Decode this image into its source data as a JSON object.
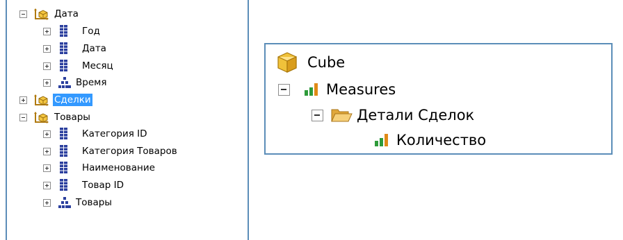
{
  "left_tree": {
    "nodes": [
      {
        "label": "Дата",
        "type": "dimension",
        "expander": "minus",
        "selected": false
      },
      {
        "label": "Год",
        "type": "attribute",
        "expander": "plus",
        "selected": false
      },
      {
        "label": "Дата",
        "type": "attribute",
        "expander": "plus",
        "selected": false
      },
      {
        "label": "Месяц",
        "type": "attribute",
        "expander": "plus",
        "selected": false
      },
      {
        "label": "Время",
        "type": "hierarchy",
        "expander": "plus",
        "selected": false
      },
      {
        "label": "Сделки",
        "type": "dimension",
        "expander": "plus",
        "selected": true
      },
      {
        "label": "Товары",
        "type": "dimension",
        "expander": "minus",
        "selected": false
      },
      {
        "label": "Категория ID",
        "type": "attribute",
        "expander": "plus",
        "selected": false
      },
      {
        "label": "Категория Товаров",
        "type": "attribute",
        "expander": "plus",
        "selected": false
      },
      {
        "label": "Наименование",
        "type": "attribute",
        "expander": "plus",
        "selected": false
      },
      {
        "label": "Товар ID",
        "type": "attribute",
        "expander": "plus",
        "selected": false
      },
      {
        "label": "Товары",
        "type": "hierarchy",
        "expander": "plus",
        "selected": false
      }
    ]
  },
  "right_tree": {
    "nodes": [
      {
        "label": "Cube",
        "type": "cube",
        "expander": "none"
      },
      {
        "label": "Measures",
        "type": "measure-group",
        "expander": "minus"
      },
      {
        "label": "Детали Сделок",
        "type": "folder",
        "expander": "minus"
      },
      {
        "label": "Количество",
        "type": "measure",
        "expander": "none"
      }
    ]
  },
  "colors": {
    "panel_border": "#5b8db8",
    "selection": "#3399ff",
    "attribute_icon": "#2b3f9e",
    "cube_icon": "#e8b930",
    "folder_icon": "#f2c14e"
  }
}
